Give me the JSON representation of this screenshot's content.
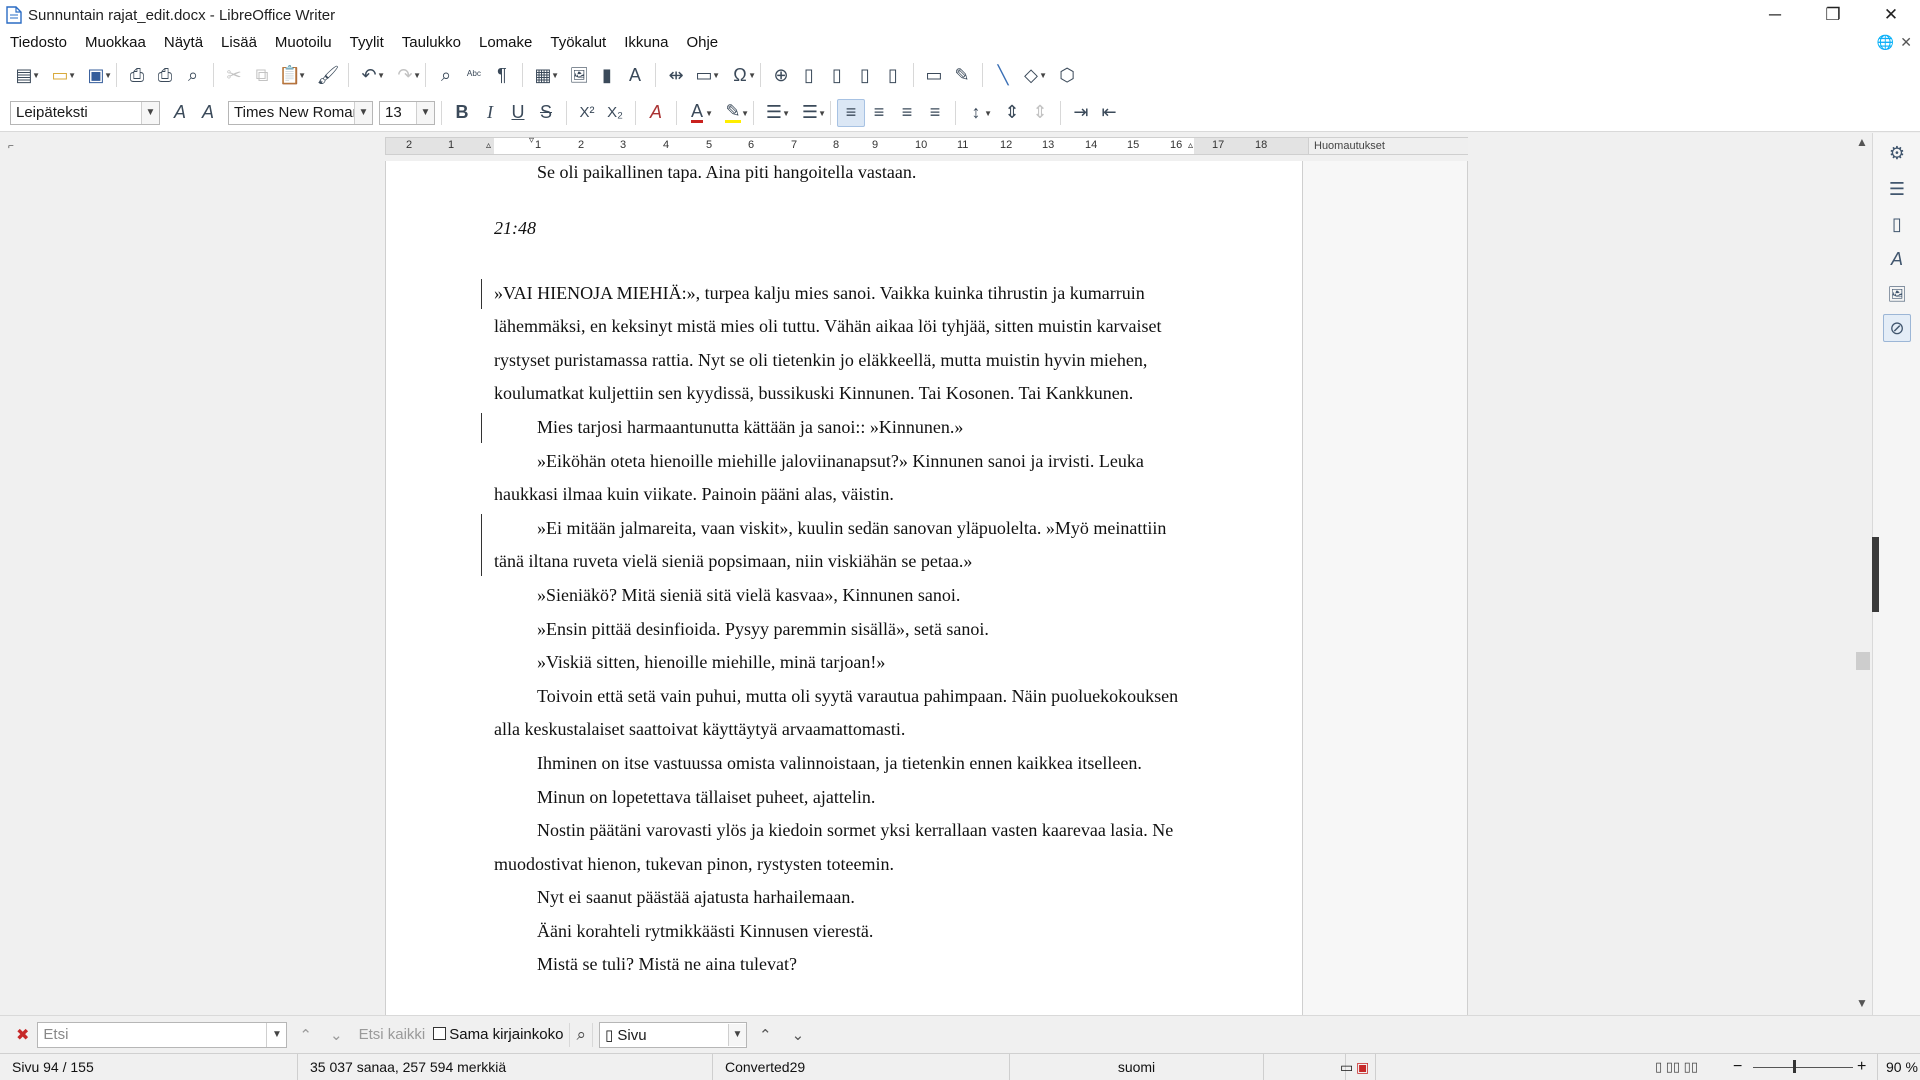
{
  "window": {
    "title": "Sunnuntain rajat_edit.docx - LibreOffice Writer",
    "minimize_glyph": "─",
    "maximize_glyph": "❐",
    "close_glyph": "✕"
  },
  "menu": [
    "Tiedosto",
    "Muokkaa",
    "Näytä",
    "Lisää",
    "Muotoilu",
    "Tyylit",
    "Taulukko",
    "Lomake",
    "Työkalut",
    "Ikkuna",
    "Ohje"
  ],
  "menu_right": {
    "globe_glyph": "🌐",
    "close_glyph": "✕"
  },
  "format_bar": {
    "paragraph_style": "Leipäteksti",
    "font_name": "Times New Roman",
    "font_size": "13"
  },
  "icons": {
    "new": "▤",
    "open": "▭",
    "save": "▣",
    "export_pdf": "⎙",
    "print": "⎙",
    "print_preview": "⌕",
    "cut": "✂",
    "copy": "⧉",
    "paste": "📋",
    "clone": "🖌",
    "undo": "↶",
    "redo": "↷",
    "find_replace": "⌕",
    "spelling": "ᴬᵇᶜ",
    "pilcrow": "¶",
    "table": "▦",
    "image": "🖼",
    "chart": "▮",
    "textbox": "A",
    "page_break": "⇹",
    "field": "▭",
    "special_char": "Ω",
    "hyperlink": "⊕",
    "footnote": "▯",
    "endnote": "▯",
    "bookmark": "▯",
    "cross_ref": "▯",
    "comment": "▭",
    "track_changes": "✎",
    "line": "╲",
    "shapes": "◇",
    "draw": "⬡",
    "style_update": "A",
    "style_new": "A",
    "bold": "B",
    "italic": "I",
    "underline": "U",
    "strike": "S",
    "superscript": "X²",
    "subscript": "X₂",
    "clear_format": "A",
    "font_color": "A",
    "highlight": "✎",
    "bullets": "☰",
    "numbering": "☰",
    "align_left": "≡",
    "align_center": "≡",
    "align_right": "≡",
    "justify": "≡",
    "line_spacing": "↕",
    "para_spacing_inc": "⇕",
    "para_spacing_dec": "⇕",
    "indent_inc": "⇥",
    "indent_dec": "⇤",
    "sb_properties": "⚙",
    "sb_styles": "☰",
    "sb_page": "▯",
    "sb_fontwork": "A",
    "sb_gallery": "🖼",
    "sb_navigator": "⊘"
  },
  "ruler": {
    "ticks": [
      "2",
      "1",
      "1",
      "2",
      "3",
      "4",
      "5",
      "6",
      "7",
      "8",
      "9",
      "10",
      "11",
      "12",
      "13",
      "14",
      "15",
      "16",
      "17",
      "18"
    ],
    "comments_label": "Huomautukset"
  },
  "document": {
    "top_line": "Se oli paikallinen tapa. Aina piti hangoitella vastaan.",
    "time_heading": "21:48",
    "paragraphs": [
      {
        "text": "»VAI HIENOJA MIEHIÄ:», turpea kalju mies sanoi. Vaikka kuinka tihrustin ja kumarruin lähemmäksi, en keksinyt mistä mies oli tuttu. Vähän aikaa löi tyhjää, sitten muistin karvaiset rystyset puristamassa rattia. Nyt se oli tietenkin jo eläkkeellä, mutta muistin hyvin miehen, koulumatkat kuljettiin sen kyydissä, bussikuski Kinnunen. Tai Kosonen. Tai Kankkunen."
      },
      {
        "text": "Mies tarjosi harmaantunutta kättään ja sanoi:: »Kinnunen.»"
      },
      {
        "text": "»Eiköhän oteta hienoille miehille jaloviinanapsut?» Kinnunen sanoi ja irvisti. Leuka haukkasi ilmaa kuin viikate. Painoin pääni alas, väistin."
      },
      {
        "text": "»Ei mitään jalmareita, vaan viskit», kuulin sedän sanovan yläpuolelta. »Myö meinattiin tänä iltana ruveta vielä sieniä popsimaan, niin viskiähän se petaa.»"
      },
      {
        "text": "»Sieniäkö? Mitä sieniä sitä vielä kasvaa», Kinnunen sanoi."
      },
      {
        "text": "»Ensin pittää desinfioida. Pysyy paremmin sisällä», setä sanoi."
      },
      {
        "text": "»Viskiä sitten, hienoille miehille, minä tarjoan!»"
      },
      {
        "text": "Toivoin että setä vain puhui, mutta oli syytä varautua pahimpaan. Näin puoluekokouksen alla keskustalaiset saattoivat käyttäytyä arvaamattomasti."
      },
      {
        "text": "Ihminen on itse vastuussa omista valinnoistaan, ja tietenkin ennen kaikkea itselleen."
      },
      {
        "text": "Minun on lopetettava tällaiset puheet, ajattelin."
      },
      {
        "text": "Nostin päätäni varovasti ylös ja kiedoin sormet yksi kerrallaan vasten kaarevaa lasia. Ne muodostivat hienon, tukevan pinon, rystysten toteemin."
      },
      {
        "text": "Nyt ei saanut päästää ajatusta harhailemaan."
      },
      {
        "text": "Ääni korahteli rytmikkäästi Kinnusen vierestä."
      },
      {
        "text": "Mistä se tuli? Mistä ne aina tulevat?"
      }
    ]
  },
  "findbar": {
    "search_placeholder": "Etsi",
    "find_all": "Etsi kaikki",
    "match_case": "Sama kirjainkoko",
    "search_type": "Sivu"
  },
  "statusbar": {
    "page": "Sivu 94 / 155",
    "word_count": "35 037 sanaa, 257 594 merkkiä",
    "page_style": "Converted29",
    "language": "suomi",
    "zoom": "90 %"
  }
}
